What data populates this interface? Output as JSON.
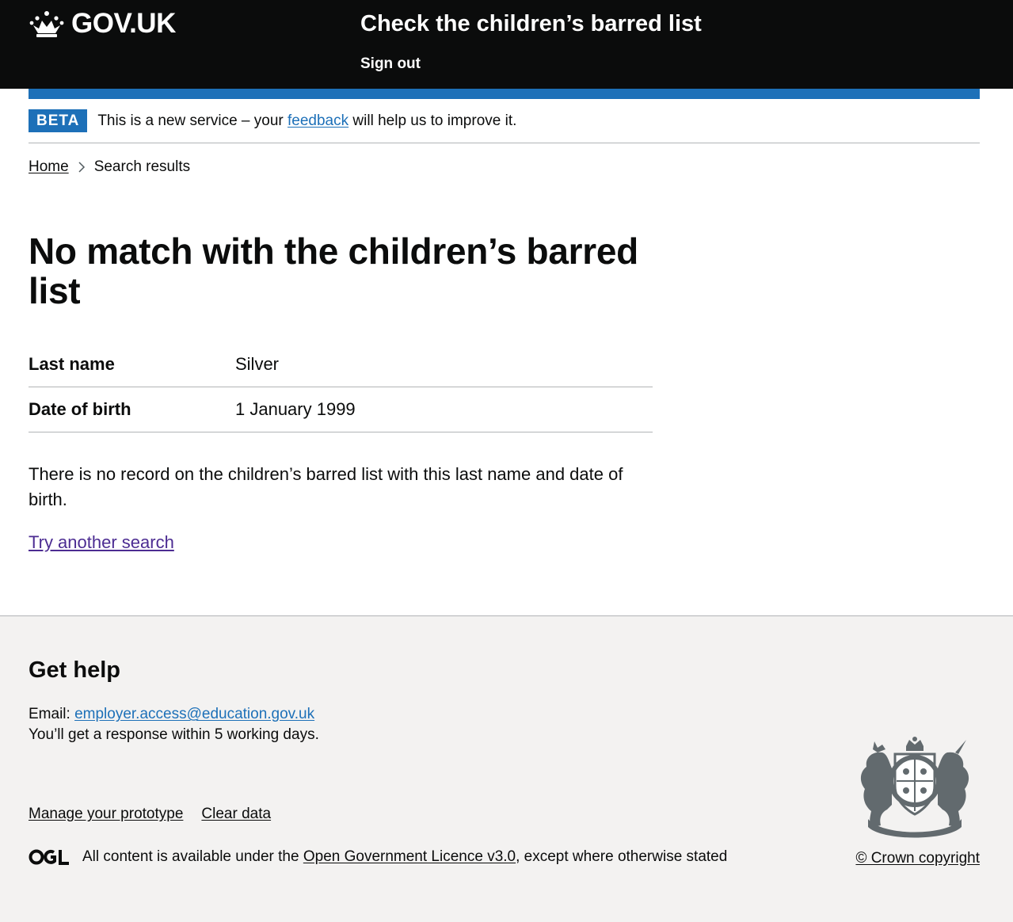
{
  "header": {
    "logo_text": "GOV.UK",
    "service_name": "Check the children’s barred list",
    "sign_out": "Sign out"
  },
  "phase_banner": {
    "tag": "BETA",
    "text_before": "This is a new service – your ",
    "link": "feedback",
    "text_after": " will help us to improve it."
  },
  "breadcrumbs": {
    "home": "Home",
    "current": "Search results"
  },
  "main": {
    "title": "No match with the children’s barred list",
    "summary": [
      {
        "key": "Last name",
        "value": "Silver"
      },
      {
        "key": "Date of birth",
        "value": "1 January 1999"
      }
    ],
    "body": "There is no record on the children’s barred list with this last name and date of birth.",
    "try_again": "Try another search"
  },
  "footer": {
    "help_title": "Get help",
    "email_label": "Email: ",
    "email": "employer.access@education.gov.uk",
    "response": "You’ll get a response within 5 working days.",
    "links": [
      "Manage your prototype",
      "Clear data"
    ],
    "licence_before": "All content is available under the ",
    "licence_link": "Open Government Licence v3.0",
    "licence_after": ", except where otherwise stated",
    "copyright": "© Crown copyright"
  },
  "colors": {
    "header_bg": "#0b0c0c",
    "brand_blue": "#1d70b8",
    "visited_link": "#4c2c92",
    "footer_bg": "#f3f2f1"
  },
  "icons": [
    "crown-icon",
    "chevron-right-icon",
    "ogl-logo",
    "royal-coat-of-arms"
  ]
}
